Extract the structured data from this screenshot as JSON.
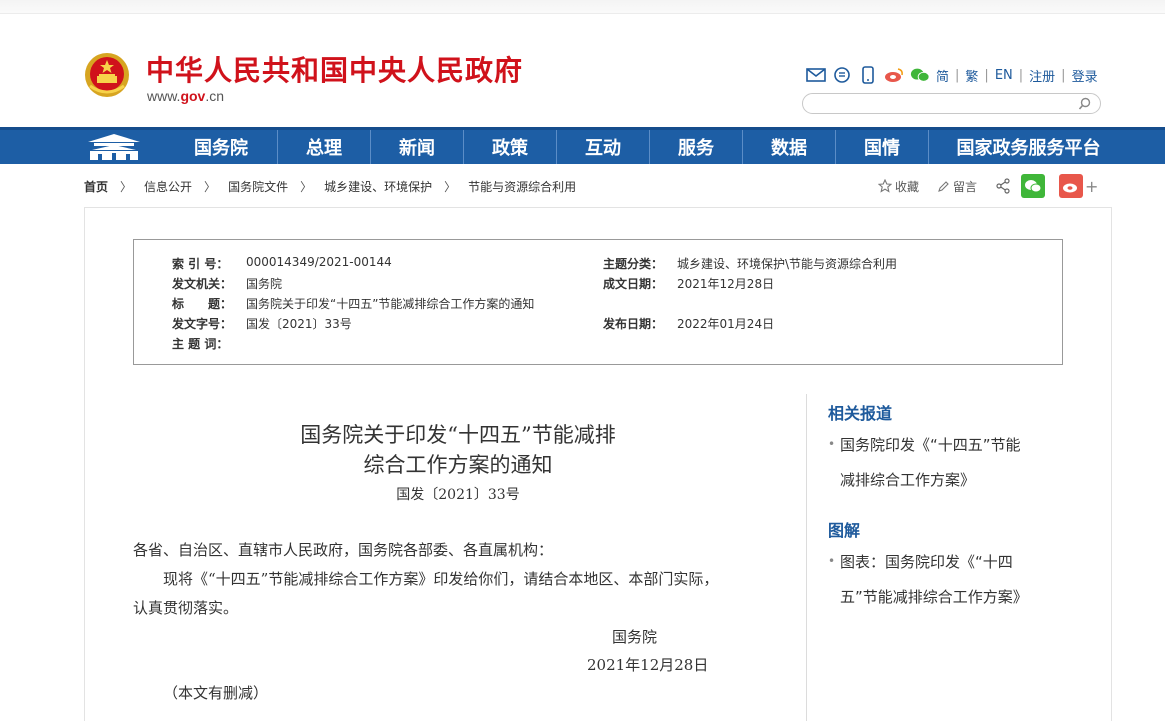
{
  "header": {
    "title": "中华人民共和国中央人民政府",
    "domain_prefix": "www.",
    "domain_gov": "gov",
    "domain_suffix": ".cn",
    "toolbar": {
      "simplified": "简",
      "traditional": "繁",
      "english": "EN",
      "register": "注册",
      "login": "登录"
    },
    "search_placeholder": ""
  },
  "nav": {
    "items": [
      "国务院",
      "总理",
      "新闻",
      "政策",
      "互动",
      "服务",
      "数据",
      "国情",
      "国家政务服务平台"
    ]
  },
  "breadcrumb": {
    "items": [
      "首页",
      "信息公开",
      "国务院文件",
      "城乡建设、环境保护",
      "节能与资源综合利用"
    ],
    "separator": "〉"
  },
  "actions": {
    "favorite": "收藏",
    "comment": "留言",
    "plus": "+"
  },
  "info": {
    "index_label": "索 引 号：",
    "index_value": "000014349/2021-00144",
    "topic_label": "主题分类：",
    "topic_value": "城乡建设、环境保护\\节能与资源综合利用",
    "issuer_label": "发文机关：",
    "issuer_value": "国务院",
    "created_label": "成文日期：",
    "created_value": "2021年12月28日",
    "title_label": "标　　题：",
    "title_value": "国务院关于印发“十四五”节能减排综合工作方案的通知",
    "docno_label": "发文字号：",
    "docno_value": "国发〔2021〕33号",
    "published_label": "发布日期：",
    "published_value": "2022年01月24日",
    "keywords_label": "主 题 词：",
    "keywords_value": ""
  },
  "article": {
    "title_line1": "国务院关于印发“十四五”节能减排",
    "title_line2": "综合工作方案的通知",
    "doc_number": "国发〔2021〕33号",
    "salutation": "各省、自治区、直辖市人民政府，国务院各部委、各直属机构：",
    "body_line1": "现将《“十四五”节能减排综合工作方案》印发给你们，请结合本地区、本部门实际，",
    "body_line2": "认真贯彻落实。",
    "signature": "国务院",
    "date": "2021年12月28日",
    "note": "（本文有删减）"
  },
  "sidebar": {
    "related_heading": "相关报道",
    "related_items": [
      {
        "line1": "国务院印发《“十四五”节能",
        "line2": "减排综合工作方案》"
      }
    ],
    "graphic_heading": "图解",
    "graphic_items": [
      {
        "line1": "图表：国务院印发《“十四",
        "line2": "五”节能减排综合工作方案》"
      }
    ]
  },
  "colors": {
    "brand_red": "#d0121b",
    "nav_blue": "#1d5ea5",
    "link_blue": "#1e5a9c",
    "wechat_green": "#3fb639",
    "weibo_red": "#e8574b"
  }
}
